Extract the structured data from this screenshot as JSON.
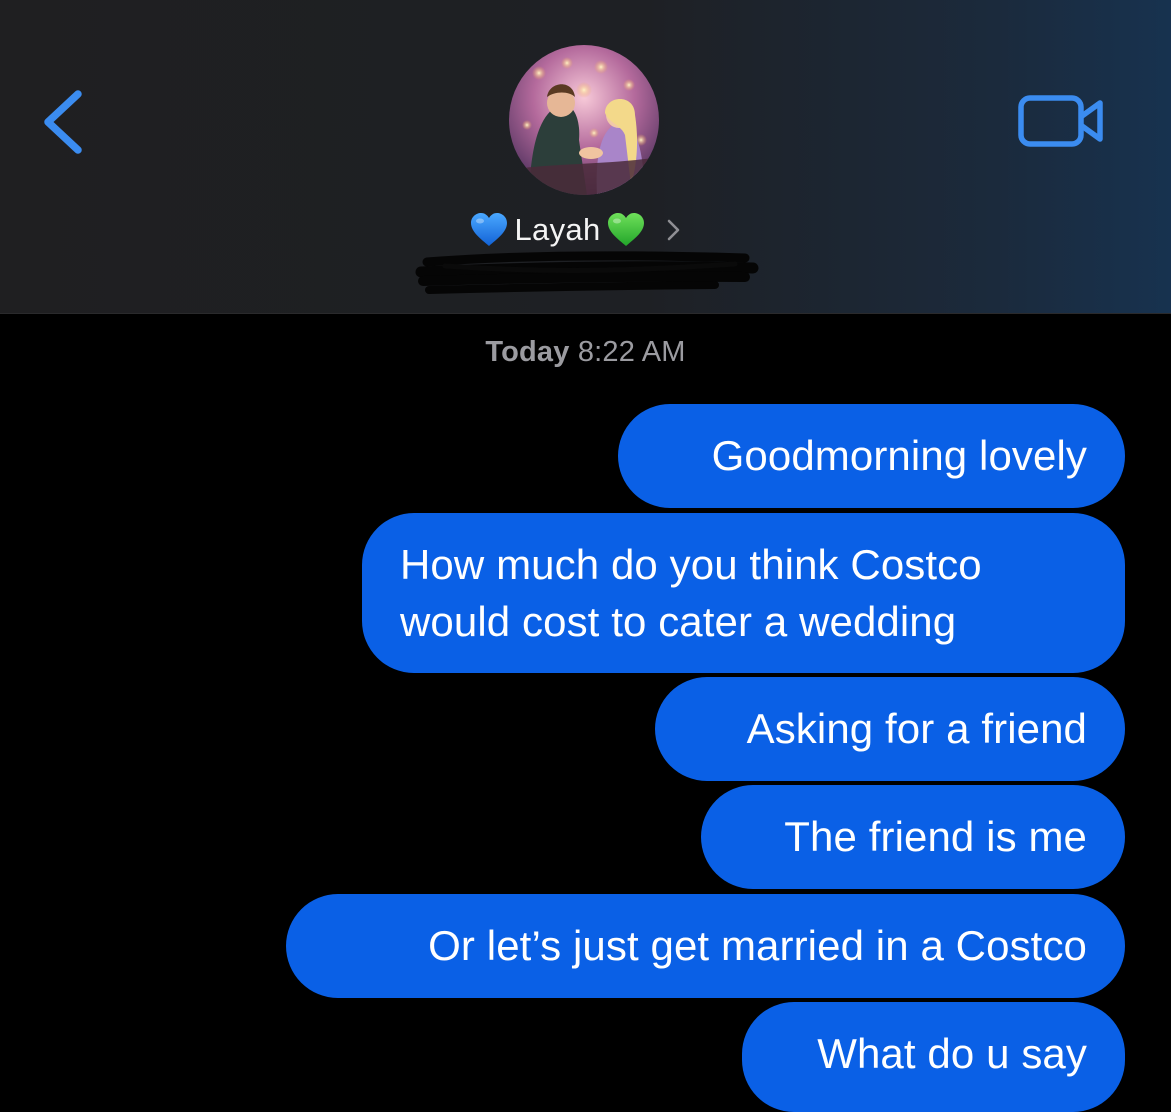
{
  "header": {
    "contact_name": "Layah",
    "back_icon": "chevron-left-icon",
    "video_icon": "video-camera-icon",
    "name_prefix_emoji": "blue-heart-icon",
    "name_suffix_emoji": "green-heart-icon",
    "details_icon": "chevron-right-icon"
  },
  "conversation": {
    "timestamp_day": "Today",
    "timestamp_time": "8:22 AM",
    "messages": [
      {
        "text": "Goodmorning lovely",
        "sender": "me"
      },
      {
        "text": "How much do you think Costco\nwould cost to cater a wedding",
        "sender": "me"
      },
      {
        "text": "Asking for a friend",
        "sender": "me"
      },
      {
        "text": "The friend is me",
        "sender": "me"
      },
      {
        "text": "Or let’s just get married in a Costco",
        "sender": "me"
      },
      {
        "text": "What do u say",
        "sender": "me"
      }
    ]
  },
  "colors": {
    "accent": "#3b8cf0",
    "bubble": "#0a60e6",
    "background": "#000000",
    "header_bg": "#1f1f21",
    "timestamp": "#9b9ba0"
  }
}
